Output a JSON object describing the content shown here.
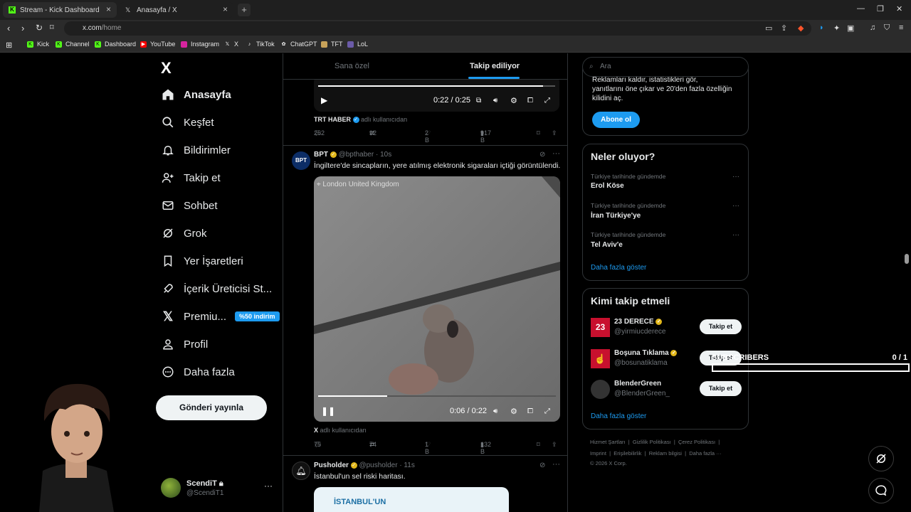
{
  "browser": {
    "tabs": [
      {
        "title": "Stream - Kick Dashboard"
      },
      {
        "title": "Anasayfa / X"
      }
    ],
    "new_tab": "+",
    "url_host": "x.com",
    "url_path": "/home",
    "bookmarks": [
      "Kick",
      "Channel",
      "Dashboard",
      "YouTube",
      "Instagram",
      "X",
      "TikTok",
      "ChatGPT",
      "TFT",
      "LoL"
    ]
  },
  "sidebar": {
    "logo": "X",
    "items": [
      {
        "label": "Anasayfa",
        "icon": "home-icon"
      },
      {
        "label": "Keşfet",
        "icon": "search-icon"
      },
      {
        "label": "Bildirimler",
        "icon": "bell-icon"
      },
      {
        "label": "Takip et",
        "icon": "add-user-icon"
      },
      {
        "label": "Sohbet",
        "icon": "mail-icon"
      },
      {
        "label": "Grok",
        "icon": "grok-icon"
      },
      {
        "label": "Yer İşaretleri",
        "icon": "bookmark-icon"
      },
      {
        "label": "İçerik Üreticisi St...",
        "icon": "rocket-icon"
      },
      {
        "label": "Premiu...",
        "icon": "x-icon",
        "badge": "%50 indirim"
      },
      {
        "label": "Profil",
        "icon": "person-icon"
      },
      {
        "label": "Daha fazla",
        "icon": "more-circle-icon"
      }
    ],
    "post_button": "Gönderi yayınla",
    "account": {
      "name": "ScendiT",
      "handle": "@ScendiT1",
      "more": "···"
    }
  },
  "feed": {
    "tabs": [
      "Sana özel",
      "Takip ediliyor"
    ],
    "active_tab": "Takip ediliyor",
    "tweet1": {
      "video_time": "0:22 / 0:25",
      "progress": 0.95,
      "source_name": "TRT HABER",
      "source_suffix": "adlı kullanıcıdan",
      "replies": "262",
      "reposts": "92",
      "likes": "2 B",
      "views": "917 B"
    },
    "tweet2": {
      "name": "BPT",
      "handle": "@bpthaber",
      "time": "· 10s",
      "text": "İngiltere'de sincapların, yere atılmış elektronik sigaraları içtiği görüntülendi.",
      "location": "London United Kingdom",
      "video_time": "0:06 / 0:22",
      "progress": 0.29,
      "source_name": "X",
      "source_suffix": "adlı kullanıcıdan",
      "replies": "75",
      "reposts": "74",
      "likes": "1 B",
      "views": "132 B"
    },
    "tweet3": {
      "name": "Pusholder",
      "handle": "@pusholder",
      "time": "· 11s",
      "text": "İstanbul'un sel riski haritası.",
      "image_text": "İSTANBUL'UN"
    }
  },
  "right": {
    "search_placeholder": "Ara",
    "premium": {
      "text1": "Reklamları kaldır, istatistikleri gör,",
      "text2": "yanıtlarını öne çıkar ve 20'den fazla özelliğin",
      "text3": "kilidini aç.",
      "button": "Abone ol"
    },
    "trends": {
      "title": "Neler oluyor?",
      "items": [
        {
          "category": "Türkiye tarihinde gündemde",
          "name": "Erol Köse"
        },
        {
          "category": "Türkiye tarihinde gündemde",
          "name": "İran Türkiye'ye"
        },
        {
          "category": "Türkiye tarihinde gündemde",
          "name": "Tel Aviv'e"
        }
      ],
      "more": "Daha fazla göster"
    },
    "follow": {
      "title": "Kimi takip etmeli",
      "items": [
        {
          "name": "23 DERECE",
          "handle": "@yirmiucderece",
          "button": "Takip et"
        },
        {
          "name": "Boşuna Tıklama",
          "handle": "@bosunatiklama",
          "button": "Takip et"
        },
        {
          "name": "BlenderGreen",
          "handle": "@BlenderGreen_",
          "button": "Takip et"
        }
      ],
      "more": "Daha fazla göster"
    },
    "footer": {
      "row1": [
        "Hizmet Şartları",
        "Gizlilik Politikası",
        "Çerez Politikası"
      ],
      "row2": [
        "Imprint",
        "Erişilebilirlik",
        "Reklam bilgisi",
        "Daha fazla ···"
      ],
      "copyright": "© 2026 X Corp."
    }
  },
  "overlay": {
    "label": "SUBSCRIBERS",
    "count": "0  / 1"
  },
  "colors": {
    "accent": "#1d9bf0",
    "kick": "#53fc18"
  }
}
